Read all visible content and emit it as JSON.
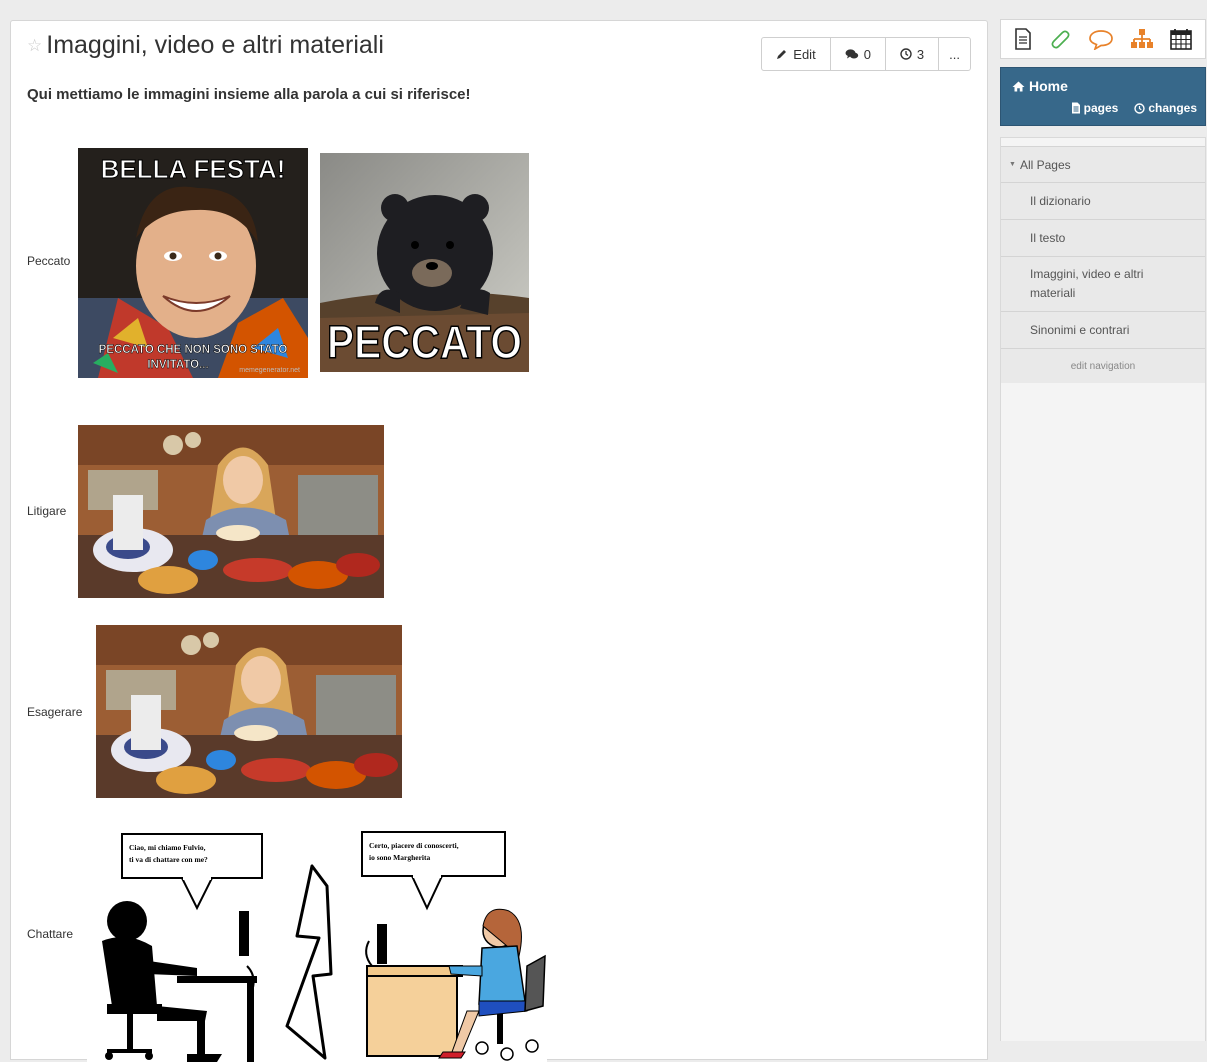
{
  "page": {
    "title": "Imaggini, video e altri materiali",
    "subtitle": "Qui mettiamo le immagini insieme alla parola a cui si riferisce!"
  },
  "toolbar": {
    "edit_label": "Edit",
    "comments_count": "0",
    "history_count": "3",
    "more_label": "..."
  },
  "content": {
    "rows": [
      {
        "label": "Peccato"
      },
      {
        "label": "Litigare"
      },
      {
        "label": "Esagerare"
      },
      {
        "label": "Chattare"
      }
    ],
    "meme1": {
      "top": "BELLA FESTA!",
      "bottom": "PECCATO CHE NON SONO STATO INVITATO",
      "wm": "memegenerator.net"
    },
    "meme2": {
      "bottom": "PECCATO"
    },
    "chat": {
      "bubble_left": "Ciao, mi chiamo Fulvio, ti va di chattare con me?",
      "bubble_right": "Certo, piacere di conoscerti, io sono Margherita"
    }
  },
  "sidebar": {
    "icons": [
      "page-icon",
      "paperclip-icon",
      "comment-icon",
      "sitemap-icon",
      "calendar-icon"
    ],
    "home": {
      "label": "Home",
      "pages_label": "pages",
      "changes_label": "changes"
    },
    "nav": {
      "all_pages": "All Pages",
      "items": [
        {
          "label": "Il dizionario"
        },
        {
          "label": "Il testo"
        },
        {
          "label": "Imaggini, video e altri materiali"
        },
        {
          "label": "Sinonimi e contrari"
        }
      ],
      "edit_navigation": "edit navigation"
    }
  },
  "colors": {
    "home_bg": "#37688a",
    "icon_green": "#4caf50",
    "icon_orange": "#e8822a"
  }
}
